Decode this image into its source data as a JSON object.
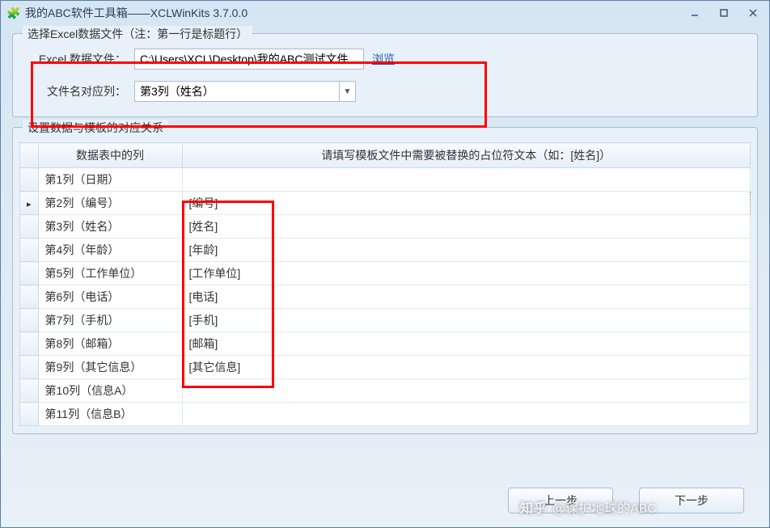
{
  "window": {
    "title": "我的ABC软件工具箱——XCLWinKits  3.7.0.0"
  },
  "group1": {
    "title": "选择Excel数据文件（注：第一行是标题行）",
    "excel_label": "Excel 数据文件：",
    "excel_value": "C:\\Users\\XCL\\Desktop\\我的ABC测试文件",
    "browse": "浏览",
    "colname_label": "文件名对应列：",
    "colname_value": "第3列（姓名）"
  },
  "group2": {
    "title": "设置数据与模板的对应关系",
    "header_col": "数据表中的列",
    "header_ph": "请填写模板文件中需要被替换的占位符文本（如：[姓名]）",
    "rows": [
      {
        "col": "第1列（日期）",
        "ph": ""
      },
      {
        "col": "第2列（编号）",
        "ph": "[编号]"
      },
      {
        "col": "第3列（姓名）",
        "ph": "[姓名]"
      },
      {
        "col": "第4列（年龄）",
        "ph": "[年龄]"
      },
      {
        "col": "第5列（工作单位）",
        "ph": "[工作单位]"
      },
      {
        "col": "第6列（电话）",
        "ph": "[电话]"
      },
      {
        "col": "第7列（手机）",
        "ph": "[手机]"
      },
      {
        "col": "第8列（邮箱）",
        "ph": "[邮箱]"
      },
      {
        "col": "第9列（其它信息）",
        "ph": "[其它信息]"
      },
      {
        "col": "第10列（信息A）",
        "ph": ""
      },
      {
        "col": "第11列（信息B）",
        "ph": ""
      }
    ],
    "selected_row_index": 1
  },
  "footer": {
    "prev": "上一步",
    "next": "下一步"
  },
  "watermark": {
    "logo": "知乎",
    "text": "@保护地球的ABC"
  }
}
